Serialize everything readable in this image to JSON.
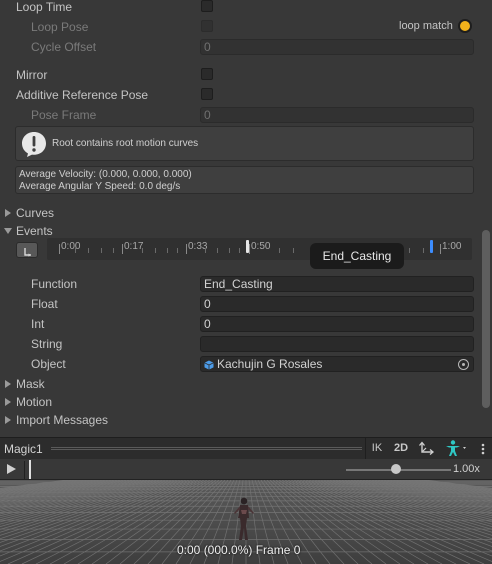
{
  "inspector": {
    "loop_time": {
      "label": "Loop Time"
    },
    "loop_pose": {
      "label": "Loop Pose",
      "match_label": "loop match"
    },
    "cycle_offset": {
      "label": "Cycle Offset",
      "value": "0"
    },
    "mirror": {
      "label": "Mirror"
    },
    "additive": {
      "label": "Additive Reference Pose"
    },
    "pose_frame": {
      "label": "Pose Frame",
      "value": "0"
    },
    "warning": {
      "text": "Root contains root motion curves"
    },
    "stats": {
      "velocity": "Average Velocity: (0.000, 0.000, 0.000)",
      "angular": "Average Angular Y Speed: 0.0 deg/s"
    },
    "curves_label": "Curves",
    "events_label": "Events",
    "timeline": {
      "ticks": [
        "0:00",
        "0:17",
        "0:33",
        "0:50",
        "1:00"
      ],
      "tooltip": "End_Casting"
    },
    "event": {
      "function_label": "Function",
      "function_value": "End_Casting",
      "float_label": "Float",
      "float_value": "0",
      "int_label": "Int",
      "int_value": "0",
      "string_label": "String",
      "string_value": "",
      "object_label": "Object",
      "object_value": "Kachujin G Rosales"
    },
    "mask_label": "Mask",
    "motion_label": "Motion",
    "import_label": "Import Messages"
  },
  "preview": {
    "title": "Magic1",
    "ik_label": "IK",
    "twod_label": "2D",
    "speed_value": "1.00x",
    "status": "0:00 (000.0%) Frame 0"
  },
  "colors": {
    "accent_orange": "#f2b21b",
    "event_blue": "#3c8dff"
  }
}
